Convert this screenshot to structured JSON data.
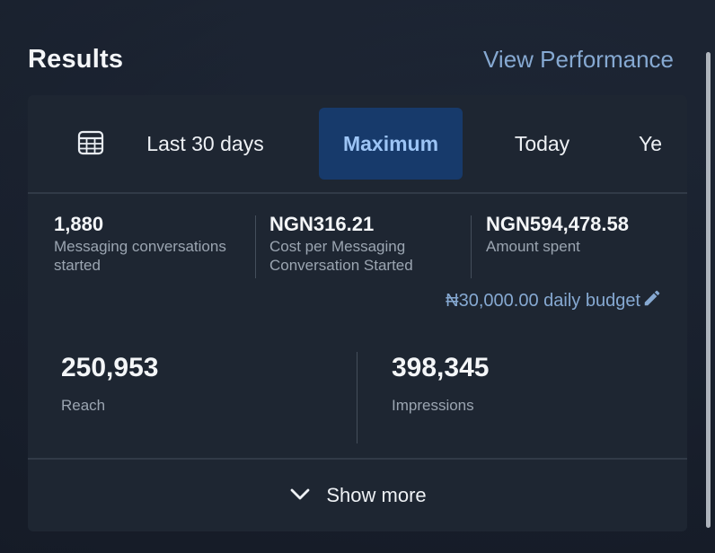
{
  "header": {
    "title": "Results",
    "view_performance": "View Performance"
  },
  "tabs": {
    "calendar_icon": "calendar-icon",
    "items": [
      {
        "label": "Last 30 days",
        "selected": false
      },
      {
        "label": "Maximum",
        "selected": true
      },
      {
        "label": "Today",
        "selected": false
      },
      {
        "label": "Ye",
        "selected": false
      }
    ]
  },
  "metrics": [
    {
      "value": "1,880",
      "label": "Messaging conversations started"
    },
    {
      "value": "NGN316.21",
      "label": "Cost per Messaging Conversation Started"
    },
    {
      "value": "NGN594,478.58",
      "label": "Amount spent"
    }
  ],
  "budget": {
    "text": "₦30,000.00 daily budget",
    "icon": "pencil-icon"
  },
  "stats": [
    {
      "value": "250,953",
      "label": "Reach"
    },
    {
      "value": "398,345",
      "label": "Impressions"
    }
  ],
  "footer": {
    "label": "Show more",
    "icon": "chevron-down-icon"
  },
  "colors": {
    "accent_link": "#86a9d2",
    "selected_tab_bg": "#173a6b",
    "card_bg": "#1e2632"
  }
}
